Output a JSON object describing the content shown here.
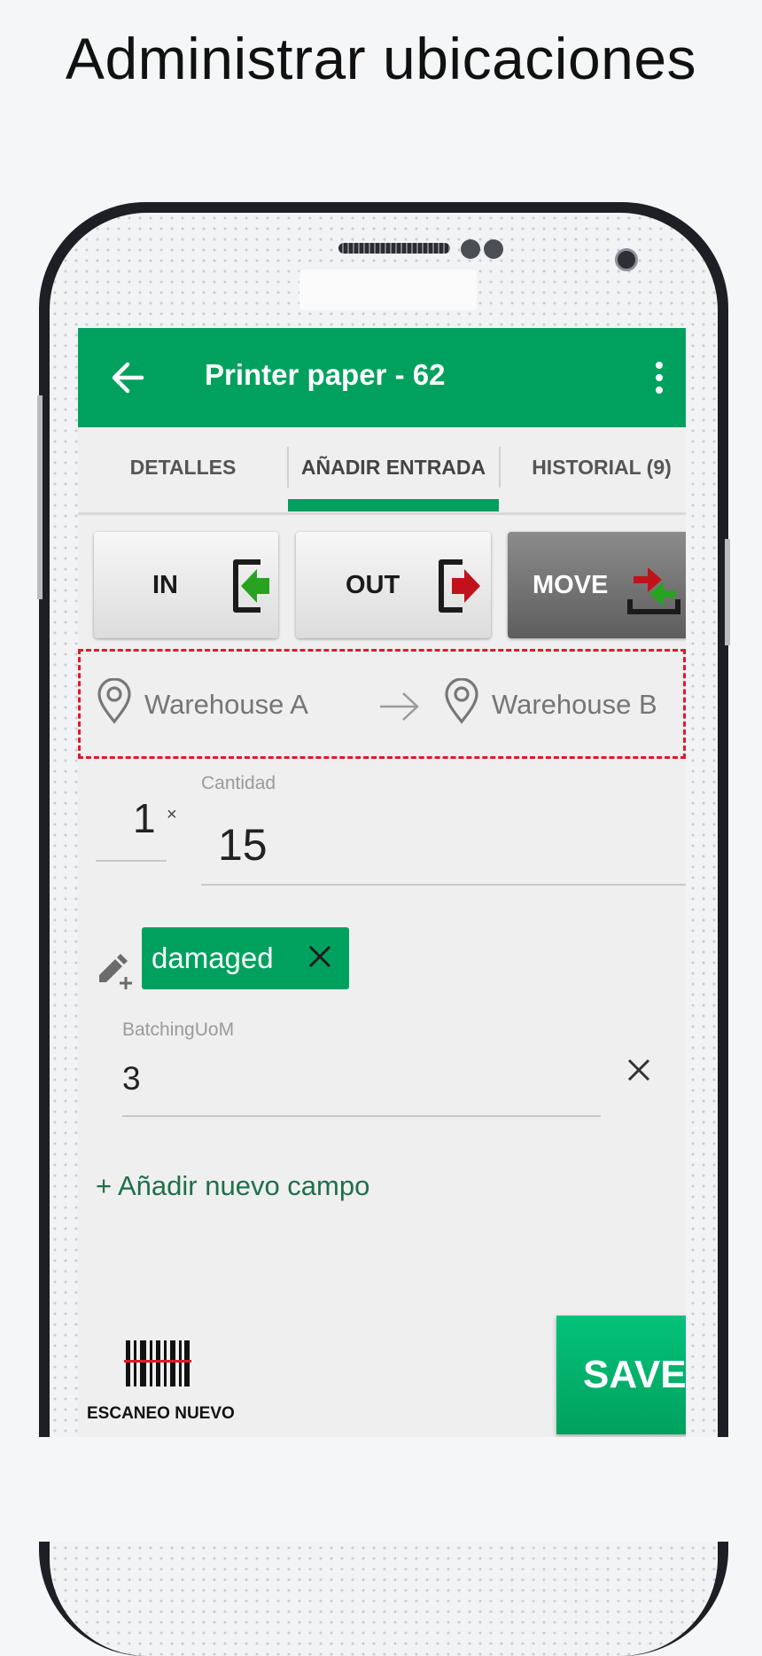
{
  "promo": {
    "title": "Administrar ubicaciones"
  },
  "appbar": {
    "title": "Printer paper - 62"
  },
  "tabs": [
    {
      "label": "DETALLES"
    },
    {
      "label": "AÑADIR ENTRADA"
    },
    {
      "label": "HISTORIAL (9)"
    }
  ],
  "modes": [
    {
      "label": "IN",
      "icon": "enter-icon",
      "color": "#27a321"
    },
    {
      "label": "OUT",
      "icon": "exit-icon",
      "color": "#c1121c"
    },
    {
      "label": "MOVE",
      "icon": "move-icon",
      "active": true
    }
  ],
  "route": {
    "from": "Warehouse A",
    "to": "Warehouse B"
  },
  "quantity": {
    "multiplier": "1",
    "multiplier_symbol": "×",
    "label": "Cantidad",
    "value": "15"
  },
  "tag": {
    "label": "damaged"
  },
  "batching": {
    "label": "BatchingUoM",
    "value": "3"
  },
  "add_field": {
    "label": "+ Añadir nuevo campo"
  },
  "scan": {
    "label": "ESCANEO NUEVO"
  },
  "save": {
    "label": "SAVE"
  },
  "colors": {
    "accent": "#00a15e",
    "dashed_border": "#e0192a",
    "save": "#04c27a"
  }
}
